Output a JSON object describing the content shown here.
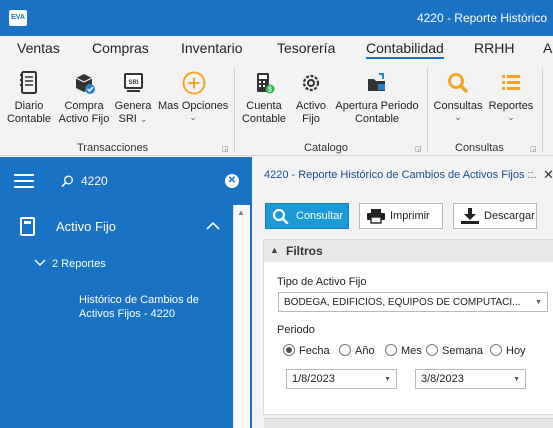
{
  "app": {
    "logo_text": "EVA",
    "window_title": "4220 - Reporte Histórico"
  },
  "menu": {
    "tabs": [
      {
        "label": "Ventas"
      },
      {
        "label": "Compras"
      },
      {
        "label": "Inventario"
      },
      {
        "label": "Tesorería"
      },
      {
        "label": "Contabilidad",
        "active": true
      },
      {
        "label": "RRHH"
      },
      {
        "label": "A"
      }
    ]
  },
  "ribbon": {
    "buttons": [
      {
        "label1": "Diario",
        "label2": "Contable",
        "icon": "ledger-icon"
      },
      {
        "label1": "Compra",
        "label2": "Activo Fijo",
        "icon": "box-check-icon"
      },
      {
        "label1": "Genera",
        "label2": "SRI",
        "icon": "sri-document-icon",
        "dropdown": true
      },
      {
        "label1": "Mas Opciones",
        "label2": "",
        "icon": "plus-circle-icon",
        "dropdown": true
      },
      {
        "label1": "Cuenta",
        "label2": "Contable",
        "icon": "account-book-icon"
      },
      {
        "label1": "Activo",
        "label2": "Fijo",
        "icon": "gear-icon"
      },
      {
        "label1": "Apertura Periodo",
        "label2": "Contable",
        "icon": "open-folder-icon"
      },
      {
        "label1": "Consultas",
        "label2": "",
        "icon": "search-icon",
        "dropdown": true
      },
      {
        "label1": "Reportes",
        "label2": "",
        "icon": "list-icon",
        "dropdown": true
      }
    ],
    "groups": [
      {
        "label": "Transacciones"
      },
      {
        "label": "Catalogo"
      },
      {
        "label": "Consultas"
      }
    ]
  },
  "nav": {
    "search_value": "4220",
    "section_label": "Activo Fijo",
    "sub_label": "2 Reportes",
    "item_label": "Histórico de Cambios de Activos Fijos - 4220"
  },
  "panel": {
    "title": "4220 - Reporte Histórico de Cambios de Activos Fijos ::.",
    "buttons": {
      "consultar": "Consultar",
      "imprimir": "Imprimir",
      "descargar": "Descargar"
    },
    "filters": {
      "title": "Filtros",
      "tipo_label": "Tipo de Activo Fijo",
      "tipo_value": "BODEGA, EDIFICIOS, EQUIPOS DE COMPUTACI...",
      "periodo_label": "Periodo",
      "period_options": [
        "Fecha",
        "Año",
        "Mes",
        "Semana",
        "Hoy"
      ],
      "period_selected": "Fecha",
      "date_from": "1/8/2023",
      "date_to": "3/8/2023"
    }
  },
  "colors": {
    "primary_blue": "#1a72c4",
    "consultar_blue": "#1a9bd8",
    "icon_orange": "#f5a623",
    "icon_blue": "#2a7fd4"
  }
}
